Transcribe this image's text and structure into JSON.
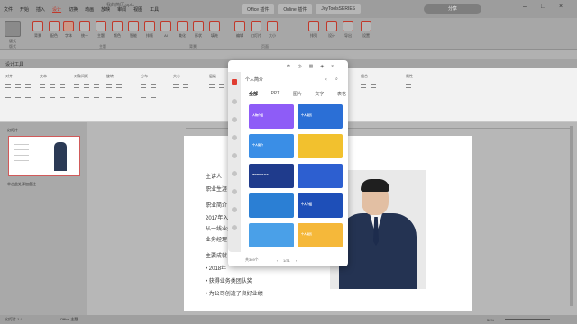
{
  "menu": {
    "items": [
      "文件",
      "开始",
      "插入",
      "设计",
      "切换",
      "动画",
      "放映",
      "审阅",
      "视图",
      "工具"
    ],
    "active_index": 3,
    "doc_title": "我的简历.pptx"
  },
  "top_tabs": [
    "Office 插件",
    "Online 插件",
    "JoyToolsSERIES"
  ],
  "share_label": "分享",
  "ribbon": {
    "buttons": [
      "版式",
      "背景",
      "配色",
      "字体",
      "统一",
      "主题",
      "颜色",
      "智能",
      "排版",
      "AI",
      "美化",
      "形状",
      "填充",
      "编辑",
      "幻灯片",
      "大小",
      "排列"
    ],
    "right_buttons": [
      "设计",
      "导出",
      "设置"
    ],
    "groups": [
      "版式",
      "主题",
      "背景",
      "页面"
    ]
  },
  "panel": {
    "title": "设计工具",
    "groups": [
      "对齐",
      "文本",
      "对象间距",
      "旋转",
      "分布",
      "大小",
      "层级",
      "组合",
      "属性"
    ]
  },
  "sidebar": {
    "header": "幻灯片",
    "notes_label": "单击此处添加备注"
  },
  "slide": {
    "lines": [
      "主讲人",
      "职业生涯",
      "职业简介",
      "2017年入职",
      "从一线业务员",
      "业务经理",
      "主要成就",
      "2018年",
      "获得业务类团队奖",
      "为公司创造了良好业绩"
    ]
  },
  "popup": {
    "search_text": "个人简介",
    "tabs": [
      "全部",
      "PPT",
      "图片",
      "文字",
      "表格"
    ],
    "active_tab": 0,
    "pager_count": "共369个",
    "pager_page": "1/31",
    "cards": [
      {
        "label": "人物介绍",
        "bg": "#8e5cf7"
      },
      {
        "label": "个人简历",
        "bg": "#2b6fd6"
      },
      {
        "label": "个人简介",
        "bg": "#3a8ee6"
      },
      {
        "label": "",
        "bg": "#f2c12e"
      },
      {
        "label": "INTRODUCE",
        "bg": "#1f3b8c"
      },
      {
        "label": "",
        "bg": "#2d5fd0"
      },
      {
        "label": "",
        "bg": "#2b7fd4"
      },
      {
        "label": "个人介绍",
        "bg": "#1e4fb8"
      },
      {
        "label": "",
        "bg": "#4aa0e8"
      },
      {
        "label": "个人简历",
        "bg": "#f5b83a"
      }
    ]
  },
  "status": {
    "left": "幻灯片 1 / 1",
    "theme": "Office 主题",
    "zoom": "50%"
  },
  "colors": {
    "accent": "#c0392b",
    "rail_active": "#e03c31"
  }
}
